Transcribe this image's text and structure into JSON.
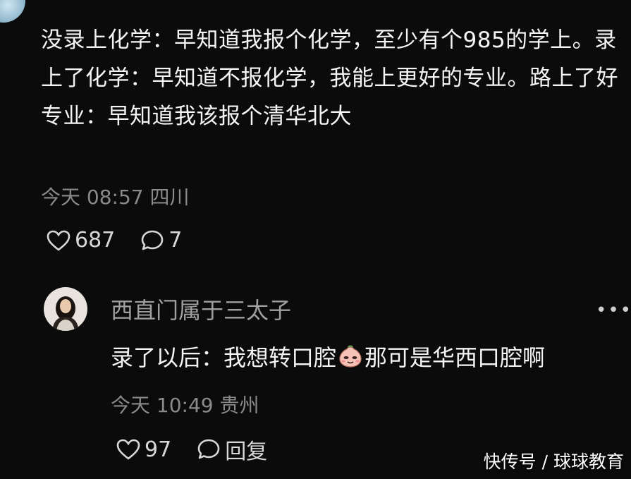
{
  "comment": {
    "text": "没录上化学：早知道我报个化学，至少有个985的学上。录上了化学：早知道不报化学，我能上更好的专业。路上了好专业：早知道我该报个清华北大",
    "time": "今天 08:57",
    "location": "四川",
    "likes": "687",
    "replies": "7",
    "like_icon": "heart-icon",
    "comment_icon": "speech-bubble-icon"
  },
  "reply": {
    "author": "西直门属于三太子",
    "text_before": "录了以后：我想转口腔",
    "emoji": "face-emoji-icon",
    "text_after": "那可是华西口腔啊",
    "time": "今天 10:49",
    "location": "贵州",
    "likes": "97",
    "reply_label": "回复",
    "more_icon": "more-dots-icon"
  },
  "watermark": "快传号 / 球球教育",
  "colors": {
    "background": "#0b0b0b",
    "text": "#f4f4f4",
    "meta": "#8a8a8a"
  }
}
